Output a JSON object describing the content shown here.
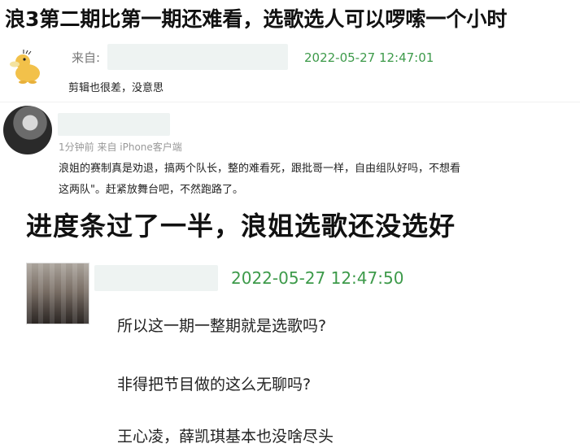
{
  "headline": "浪3第二期比第一期还难看，选歌选人可以啰嗦一个小时",
  "comment1": {
    "from_label": "来自:",
    "timestamp": "2022-05-27 12:47:01",
    "text": "剪辑也很差，没意思",
    "avatar_icon": "duck-avatar-icon"
  },
  "comment2": {
    "meta": "1分钟前  来自 iPhone客户端",
    "line1": "浪姐的赛制真是劝退，搞两个队长，整的难看死，跟批哥一样，自由组队好吗，不想看",
    "line2": "这两队\"。赶紧放舞台吧，不然跑路了。"
  },
  "caption": "进度条过了一半，浪姐选歌还没选好",
  "comment3": {
    "timestamp": "2022-05-27 12:47:50",
    "lines": [
      "所以这一期一整期就是选歌吗?",
      "非得把节目做的这么无聊吗?",
      "王心凌，薛凯琪基本也没啥尽头"
    ]
  }
}
